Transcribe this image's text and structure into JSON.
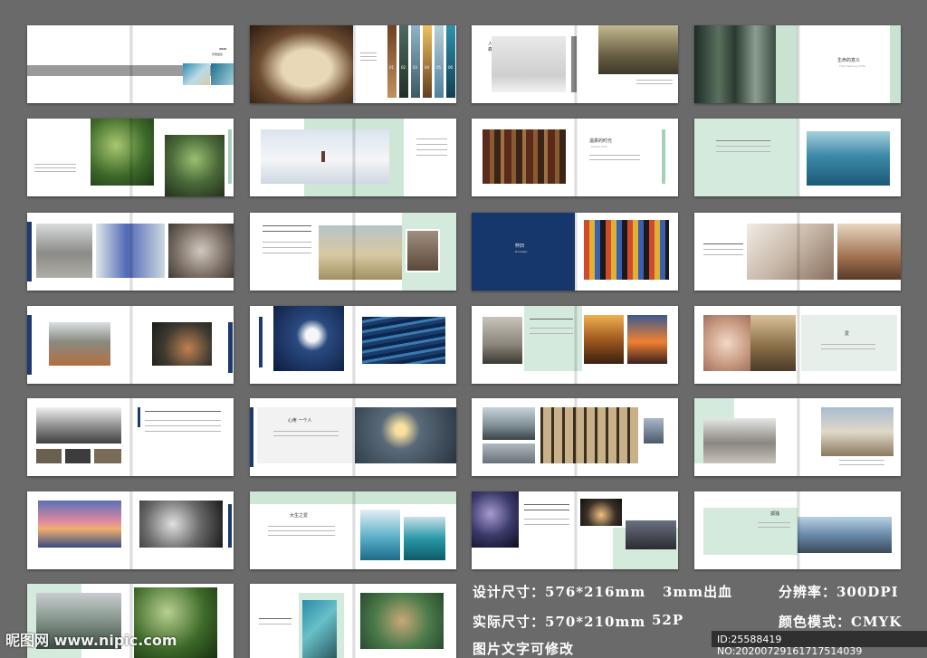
{
  "pages": {
    "p1_year": "2020",
    "p1_subtitle": "年册画性",
    "p2_nums": [
      "01",
      "02",
      "03",
      "04",
      "05",
      "06"
    ],
    "p3_title": "人与\n森林",
    "p4_title": "生命的意义",
    "p4_sub": "The meaning of life",
    "p7_title": "温柔的时光",
    "p7_sub": "Gentle time",
    "p11_title": "怀旧",
    "p11_sub": "Nostalgic",
    "p16_title": "爱",
    "p18_title": "心疼 一个人",
    "p22_title": "大生之爱",
    "p24_title": "孤独"
  },
  "specs": {
    "size_design": "设计尺寸：576*216mm",
    "bleed": "3mm出血",
    "resolution": "分辨率：300DPI",
    "size_actual": "实际尺寸：570*210mm",
    "pages": "52P",
    "color_mode": "颜色模式：CMYK",
    "editable": "图片文字可修改"
  },
  "watermark": {
    "site": "昵图网 www.nipic.com",
    "id": "ID:25588419 NO:20200729161717514039"
  }
}
